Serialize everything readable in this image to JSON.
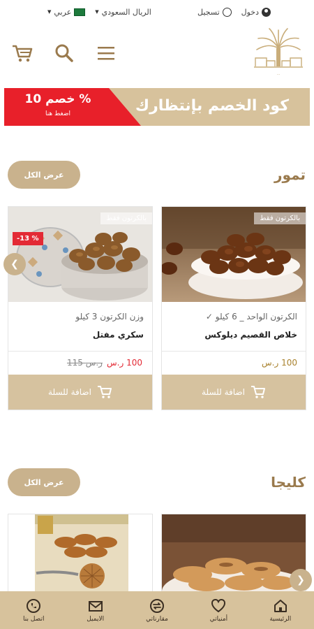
{
  "topbar": {
    "login": "دخول",
    "register": "تسجيل",
    "currency": "الريال السعودي",
    "language": "عربي"
  },
  "header": {
    "logo_caption": "..."
  },
  "banner": {
    "title": "كود الخصم بإنتظارك",
    "discount": "خصم 10 %",
    "cta": "اضغط هنا"
  },
  "sections": [
    {
      "title": "تمور",
      "view_all": "عرض الكل",
      "products": [
        {
          "badge": "بالكرتون فقط",
          "weight": "الكرتون الواحد _ 6 كيلو ✓",
          "name": "خلاص القصيم ديلوكس",
          "price": "100 ر.س",
          "add_label": "اضافة للسلة"
        },
        {
          "badge": "بالكرتون فقط",
          "discount_badge": "-13 %",
          "weight": "وزن الكرتون 3 كيلو",
          "name": "سكري مفتل",
          "price": "100 ر.س",
          "old_price": "115 ر.س",
          "add_label": "اضافة للسلة"
        }
      ]
    },
    {
      "title": "كليجا",
      "view_all": "عرض الكل"
    }
  ],
  "bottomnav": {
    "items": [
      {
        "label": "الرئيسية",
        "icon": "home-icon"
      },
      {
        "label": "أمنياتي",
        "icon": "heart-icon"
      },
      {
        "label": "مقارناتي",
        "icon": "compare-icon"
      },
      {
        "label": "الايميل",
        "icon": "mail-icon"
      },
      {
        "label": "اتصل بنا",
        "icon": "phone-icon"
      }
    ]
  },
  "colors": {
    "brand_beige": "#d7c29c",
    "brand_brown": "#9a7a4d",
    "sale_red": "#e32a35",
    "price_gold": "#a9822e"
  }
}
